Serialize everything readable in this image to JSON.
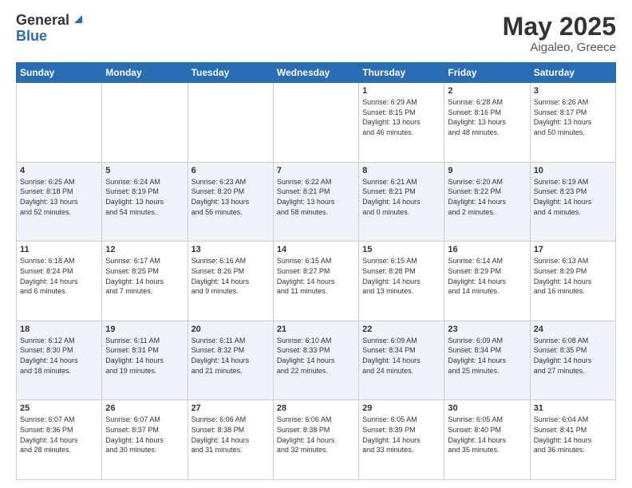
{
  "logo": {
    "general": "General",
    "blue": "Blue"
  },
  "title": {
    "month_year": "May 2025",
    "location": "Aigaleo, Greece"
  },
  "weekdays": [
    "Sunday",
    "Monday",
    "Tuesday",
    "Wednesday",
    "Thursday",
    "Friday",
    "Saturday"
  ],
  "weeks": [
    [
      {
        "day": "",
        "info": ""
      },
      {
        "day": "",
        "info": ""
      },
      {
        "day": "",
        "info": ""
      },
      {
        "day": "",
        "info": ""
      },
      {
        "day": "1",
        "info": "Sunrise: 6:29 AM\nSunset: 8:15 PM\nDaylight: 13 hours\nand 46 minutes."
      },
      {
        "day": "2",
        "info": "Sunrise: 6:28 AM\nSunset: 8:16 PM\nDaylight: 13 hours\nand 48 minutes."
      },
      {
        "day": "3",
        "info": "Sunrise: 6:26 AM\nSunset: 8:17 PM\nDaylight: 13 hours\nand 50 minutes."
      }
    ],
    [
      {
        "day": "4",
        "info": "Sunrise: 6:25 AM\nSunset: 8:18 PM\nDaylight: 13 hours\nand 52 minutes."
      },
      {
        "day": "5",
        "info": "Sunrise: 6:24 AM\nSunset: 8:19 PM\nDaylight: 13 hours\nand 54 minutes."
      },
      {
        "day": "6",
        "info": "Sunrise: 6:23 AM\nSunset: 8:20 PM\nDaylight: 13 hours\nand 56 minutes."
      },
      {
        "day": "7",
        "info": "Sunrise: 6:22 AM\nSunset: 8:21 PM\nDaylight: 13 hours\nand 58 minutes."
      },
      {
        "day": "8",
        "info": "Sunrise: 6:21 AM\nSunset: 8:21 PM\nDaylight: 14 hours\nand 0 minutes."
      },
      {
        "day": "9",
        "info": "Sunrise: 6:20 AM\nSunset: 8:22 PM\nDaylight: 14 hours\nand 2 minutes."
      },
      {
        "day": "10",
        "info": "Sunrise: 6:19 AM\nSunset: 8:23 PM\nDaylight: 14 hours\nand 4 minutes."
      }
    ],
    [
      {
        "day": "11",
        "info": "Sunrise: 6:18 AM\nSunset: 8:24 PM\nDaylight: 14 hours\nand 6 minutes."
      },
      {
        "day": "12",
        "info": "Sunrise: 6:17 AM\nSunset: 8:25 PM\nDaylight: 14 hours\nand 7 minutes."
      },
      {
        "day": "13",
        "info": "Sunrise: 6:16 AM\nSunset: 8:26 PM\nDaylight: 14 hours\nand 9 minutes."
      },
      {
        "day": "14",
        "info": "Sunrise: 6:15 AM\nSunset: 8:27 PM\nDaylight: 14 hours\nand 11 minutes."
      },
      {
        "day": "15",
        "info": "Sunrise: 6:15 AM\nSunset: 8:28 PM\nDaylight: 14 hours\nand 13 minutes."
      },
      {
        "day": "16",
        "info": "Sunrise: 6:14 AM\nSunset: 8:29 PM\nDaylight: 14 hours\nand 14 minutes."
      },
      {
        "day": "17",
        "info": "Sunrise: 6:13 AM\nSunset: 8:29 PM\nDaylight: 14 hours\nand 16 minutes."
      }
    ],
    [
      {
        "day": "18",
        "info": "Sunrise: 6:12 AM\nSunset: 8:30 PM\nDaylight: 14 hours\nand 18 minutes."
      },
      {
        "day": "19",
        "info": "Sunrise: 6:11 AM\nSunset: 8:31 PM\nDaylight: 14 hours\nand 19 minutes."
      },
      {
        "day": "20",
        "info": "Sunrise: 6:11 AM\nSunset: 8:32 PM\nDaylight: 14 hours\nand 21 minutes."
      },
      {
        "day": "21",
        "info": "Sunrise: 6:10 AM\nSunset: 8:33 PM\nDaylight: 14 hours\nand 22 minutes."
      },
      {
        "day": "22",
        "info": "Sunrise: 6:09 AM\nSunset: 8:34 PM\nDaylight: 14 hours\nand 24 minutes."
      },
      {
        "day": "23",
        "info": "Sunrise: 6:09 AM\nSunset: 8:34 PM\nDaylight: 14 hours\nand 25 minutes."
      },
      {
        "day": "24",
        "info": "Sunrise: 6:08 AM\nSunset: 8:35 PM\nDaylight: 14 hours\nand 27 minutes."
      }
    ],
    [
      {
        "day": "25",
        "info": "Sunrise: 6:07 AM\nSunset: 8:36 PM\nDaylight: 14 hours\nand 28 minutes."
      },
      {
        "day": "26",
        "info": "Sunrise: 6:07 AM\nSunset: 8:37 PM\nDaylight: 14 hours\nand 30 minutes."
      },
      {
        "day": "27",
        "info": "Sunrise: 6:06 AM\nSunset: 8:38 PM\nDaylight: 14 hours\nand 31 minutes."
      },
      {
        "day": "28",
        "info": "Sunrise: 6:06 AM\nSunset: 8:38 PM\nDaylight: 14 hours\nand 32 minutes."
      },
      {
        "day": "29",
        "info": "Sunrise: 6:05 AM\nSunset: 8:39 PM\nDaylight: 14 hours\nand 33 minutes."
      },
      {
        "day": "30",
        "info": "Sunrise: 6:05 AM\nSunset: 8:40 PM\nDaylight: 14 hours\nand 35 minutes."
      },
      {
        "day": "31",
        "info": "Sunrise: 6:04 AM\nSunset: 8:41 PM\nDaylight: 14 hours\nand 36 minutes."
      }
    ]
  ]
}
